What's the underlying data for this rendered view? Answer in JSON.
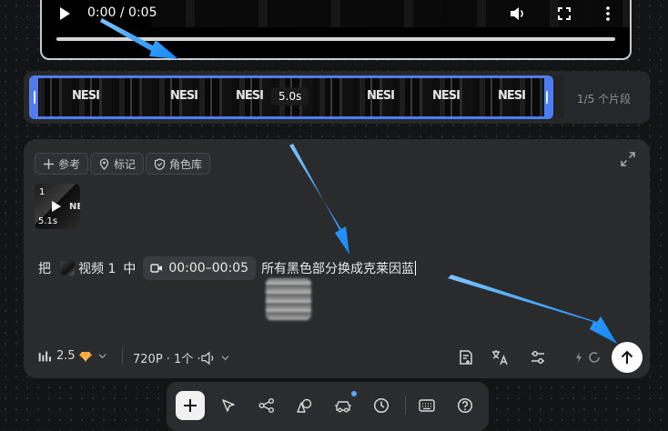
{
  "player": {
    "time": "0:00 / 0:05",
    "icons": [
      "play-icon",
      "volume-icon",
      "fullscreen-icon",
      "more-vertical-icon"
    ]
  },
  "strip": {
    "logo_text": "NESI",
    "duration_badge": "5.0s",
    "clip_count": "1/5 个片段",
    "accent": "#4d7df0"
  },
  "prompt": {
    "chips": [
      {
        "label": "参考",
        "icon": "plus-icon"
      },
      {
        "label": "标记",
        "icon": "location-pin-icon"
      },
      {
        "label": "角色库",
        "icon": "shield-icon"
      }
    ],
    "reference": {
      "index": "1",
      "duration": "5.1s",
      "logo": "NE"
    },
    "sentence": {
      "prefix": "把",
      "video_ref": "视频 1",
      "middle": "中",
      "time_range": "00:00–00:05",
      "instruction": "所有黑色部分换成克莱因蓝"
    },
    "bottom": {
      "model": "2.5",
      "spec": "720P · 1个 · ",
      "icons": [
        "bar-chart-icon",
        "gem-icon",
        "speaker-icon",
        "note-add-icon",
        "translate-icon",
        "settings-sliders-icon",
        "sparkle-icon",
        "loading-icon",
        "send-arrow-up-icon"
      ]
    }
  },
  "toolbar": {
    "icons": [
      "plus-icon",
      "cursor-icon",
      "workflow-icon",
      "shapes-icon",
      "car-icon",
      "clock-icon",
      "keyboard-icon",
      "help-icon"
    ],
    "notification_color": "#5aa8ff"
  },
  "annotation_color": "#1e96ff"
}
